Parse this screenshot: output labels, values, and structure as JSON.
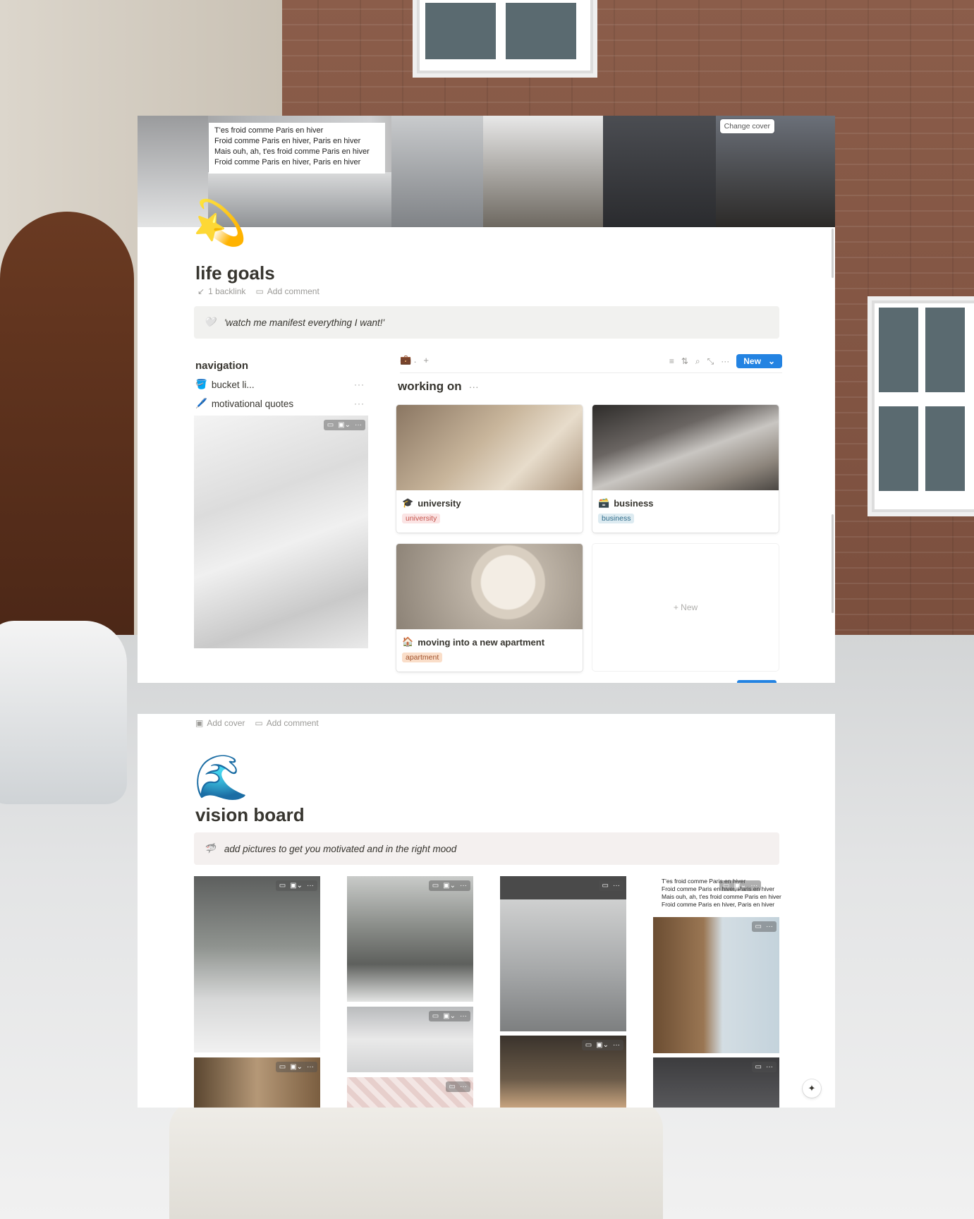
{
  "top_page": {
    "cover_text": [
      "T'es froid comme Paris en hiver",
      "Froid comme Paris en hiver, Paris en hiver",
      "Mais ouh, ah, t'es froid comme Paris en hiver",
      "Froid comme Paris en hiver, Paris en hiver"
    ],
    "change_cover": "Change cover",
    "icon": "💫",
    "title": "life goals",
    "backlink": "1 backlink",
    "add_comment": "Add comment",
    "callout_icon": "🤍",
    "callout_text": "'watch me manifest everything I want!'",
    "navigation": {
      "heading": "navigation",
      "items": [
        {
          "icon": "🪣",
          "label": "bucket li..."
        },
        {
          "icon": "🖊️",
          "label": "motivational quotes"
        }
      ]
    },
    "database": {
      "view_icon": "💼",
      "new_button": "New",
      "title": "working on",
      "cards": [
        {
          "icon": "🎓",
          "title": "university",
          "tag": "university",
          "tag_bg": "#fbe4e4",
          "tag_color": "#c4554d"
        },
        {
          "icon": "🗃️",
          "title": "business",
          "tag": "business",
          "tag_bg": "#ddebf1",
          "tag_color": "#2e6b8a"
        },
        {
          "icon": "🏠",
          "title": "moving into a new apartment",
          "tag": "apartment",
          "tag_bg": "#fadec9",
          "tag_color": "#a0522d"
        }
      ],
      "new_card": "+ New"
    }
  },
  "bottom_page": {
    "add_cover": "Add cover",
    "add_comment": "Add comment",
    "icon": "🌊",
    "title": "vision board",
    "callout_icon": "🦈",
    "callout_text": "add pictures to get you motivated and in the right mood",
    "gallery_text": [
      "T'es froid comme Paris en hiver",
      "Froid comme Paris en hiver, Paris en hiver",
      "Mais ouh, ah, t'es froid comme Paris en hiver",
      "Froid comme Paris en hiver, Paris en hiver"
    ],
    "corner_icon": "✦"
  },
  "colors": {
    "accent": "#2383e2",
    "callout_bg": "#f1f1ef",
    "muted_text": "#9b9a97"
  }
}
